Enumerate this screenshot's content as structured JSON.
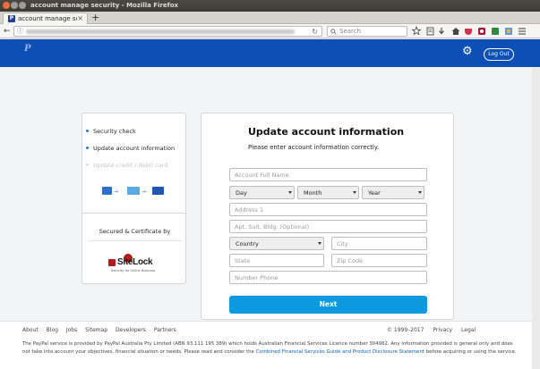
{
  "window": {
    "title": "account manage security - Mozilla Firefox"
  },
  "tab": {
    "title": "account manage security",
    "close": "×",
    "new_tab": "+"
  },
  "nav": {
    "back": "←",
    "info": "ⓘ",
    "reload": "↻",
    "search_placeholder": "Search"
  },
  "toolbar_icons": [
    "star-icon",
    "reader-icon",
    "download-icon",
    "home-icon",
    "pocket-icon",
    "shield-icon",
    "extension-icon",
    "sync-icon",
    "menu-icon"
  ],
  "header": {
    "logout_label": "Log Out",
    "brand_color": "#0e4fb5"
  },
  "steps": [
    {
      "label": "Security check",
      "state": "done"
    },
    {
      "label": "Update account information",
      "state": "current"
    },
    {
      "label": "Update credit / debit card",
      "state": "disabled"
    }
  ],
  "secured": {
    "title": "Secured & Certificate by",
    "logo_text": "SiteLock",
    "logo_sub": "Security for Online Business"
  },
  "form": {
    "title": "Update account information",
    "subtitle": "Please enter account information correctly.",
    "full_name_placeholder": "Account Full Name",
    "day": "Day",
    "month": "Month",
    "year": "Year",
    "address1_placeholder": "Address 1",
    "address2_placeholder": "Apt, Suit, Bldg. (Optional)",
    "country": "Country",
    "city_placeholder": "City",
    "state_placeholder": "State",
    "zip_placeholder": "Zip Code",
    "phone_placeholder": "Number Phone",
    "next_label": "Next",
    "button_color": "#0d99e0"
  },
  "footer": {
    "links": [
      "About",
      "Blog",
      "Jobs",
      "Sitemap",
      "Developers",
      "Partners"
    ],
    "copyright": "© 1999–2017",
    "privacy": "Privacy",
    "legal": "Legal",
    "disclaimer_part1": "The PayPal service is provided by PayPal Australia Pty Limited (ABN 93 111 195 389) which holds Australian Financial Services Licence number 304962. Any information provided is general only and does not take into account your objectives, financial situation or needs. Please read and consider the ",
    "disclaimer_link": "Combined Financial Services Guide and Product Disclosure Statement",
    "disclaimer_part2": " before acquiring or using the service."
  }
}
